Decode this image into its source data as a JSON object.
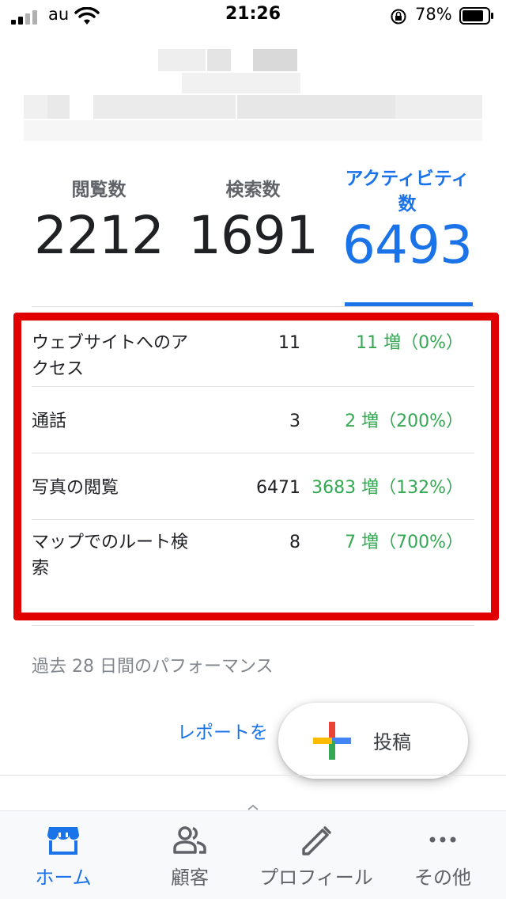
{
  "status_bar": {
    "carrier": "au",
    "time": "21:26",
    "battery_percent": "78%"
  },
  "stats_tabs": [
    {
      "label": "閲覧数",
      "value": "2212",
      "selected": false
    },
    {
      "label": "検索数",
      "value": "1691",
      "selected": false
    },
    {
      "label": "アクティビティ数",
      "value": "6493",
      "selected": true
    }
  ],
  "metrics": [
    {
      "label": "ウェブサイトへのアクセス",
      "value": "11",
      "change": "11 増（0%）"
    },
    {
      "label": "通話",
      "value": "3",
      "change": "2 増（200%）"
    },
    {
      "label": "写真の閲覧",
      "value": "6471",
      "change": "3683 増（132%）"
    },
    {
      "label": "マップでのルート検索",
      "value": "8",
      "change": "7 増（700%）"
    }
  ],
  "period_caption": "過去 28 日間のパフォーマンス",
  "report_link": "レポートを",
  "fab": {
    "label": "投稿",
    "icon": "plus-icon"
  },
  "bottom_nav": [
    {
      "label": "ホーム",
      "icon": "storefront-icon",
      "active": true
    },
    {
      "label": "顧客",
      "icon": "people-icon",
      "active": false
    },
    {
      "label": "プロフィール",
      "icon": "pencil-icon",
      "active": false
    },
    {
      "label": "その他",
      "icon": "more-horizontal-icon",
      "active": false
    }
  ],
  "colors": {
    "accent": "#1a73e8",
    "positive_change": "#34a853",
    "highlight_box": "#e00000"
  }
}
